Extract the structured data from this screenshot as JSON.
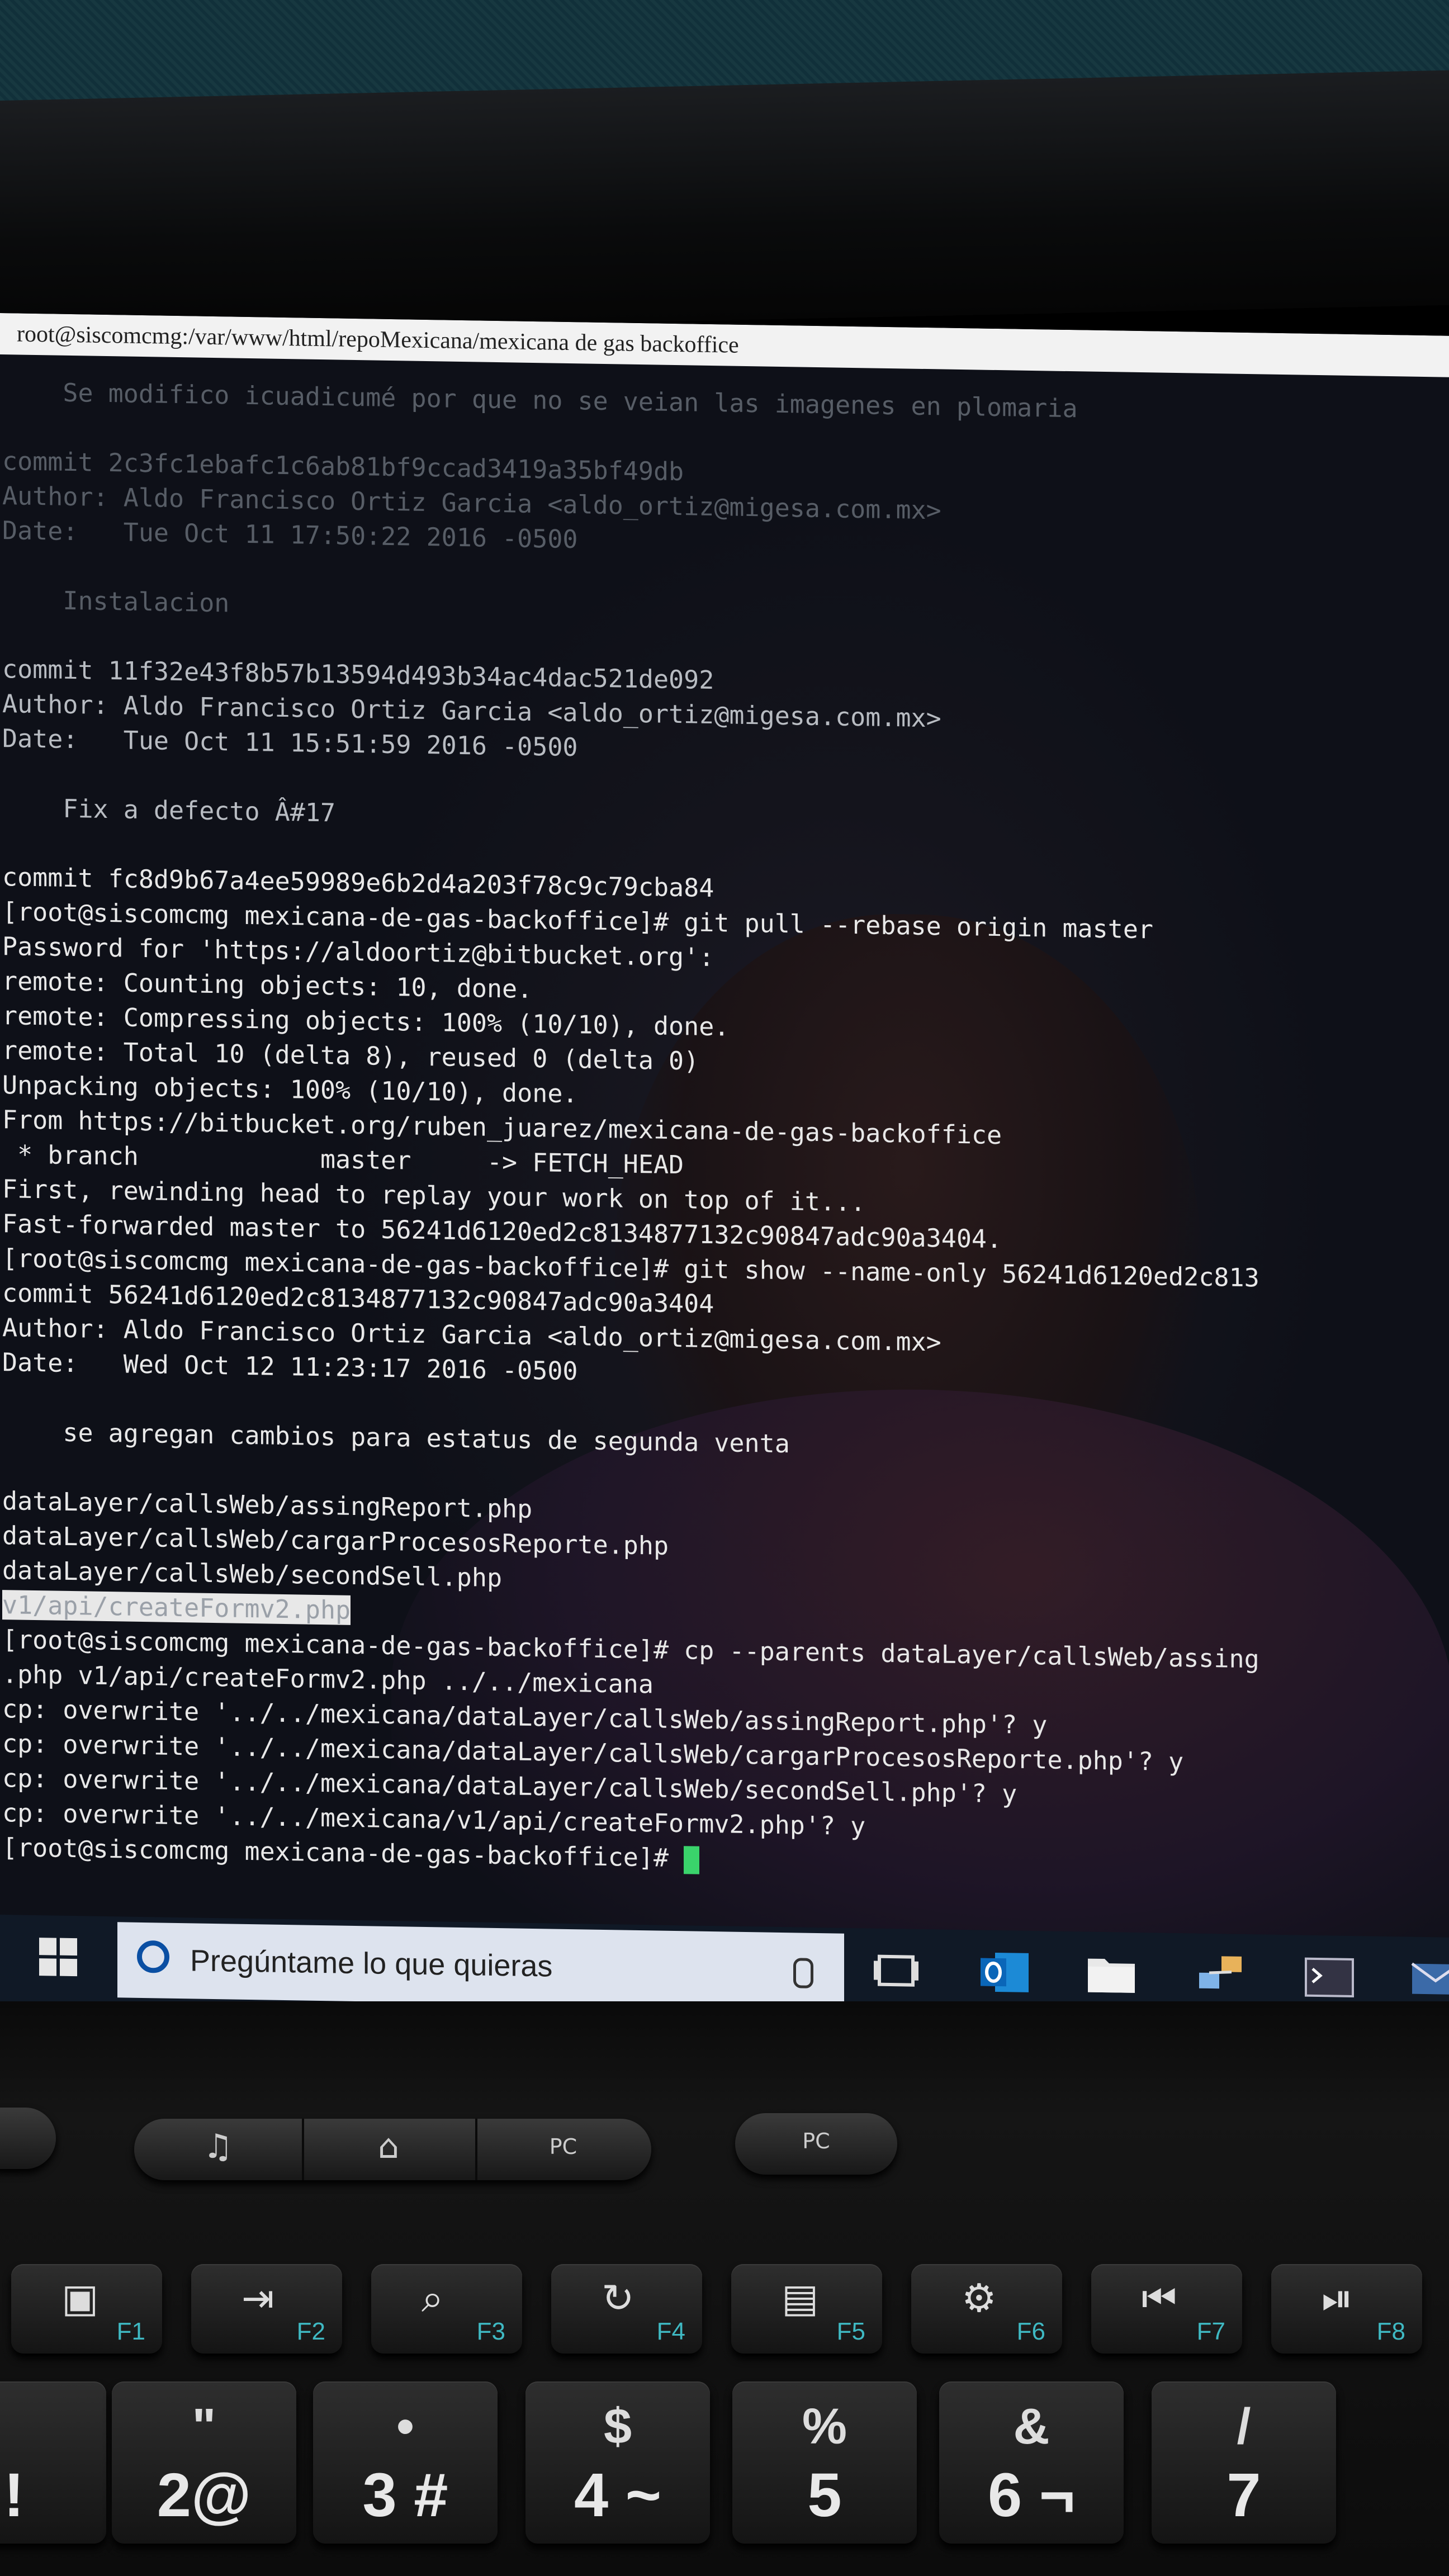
{
  "window": {
    "title": "root@siscomcmg:/var/www/html/repoMexicana/mexicana de gas backoffice"
  },
  "terminal": {
    "lines": [
      {
        "text": "    Se modifico icuadicumé por que no se veian las imagenes en plomaria",
        "tone": "dim"
      },
      {
        "text": "",
        "tone": "dim"
      },
      {
        "text": "commit 2c3fc1ebafc1c6ab81bf9ccad3419a35bf49db",
        "tone": "dim"
      },
      {
        "text": "Author: Aldo Francisco Ortiz Garcia <aldo_ortiz@migesa.com.mx>",
        "tone": "dim"
      },
      {
        "text": "Date:   Tue Oct 11 17:50:22 2016 -0500",
        "tone": "dim"
      },
      {
        "text": "",
        "tone": "dim"
      },
      {
        "text": "    Instalacion",
        "tone": "dim"
      },
      {
        "text": "",
        "tone": "dim"
      },
      {
        "text": "commit 11f32e43f8b57b13594d493b34ac4dac521de092",
        "tone": "mid"
      },
      {
        "text": "Author: Aldo Francisco Ortiz Garcia <aldo_ortiz@migesa.com.mx>",
        "tone": "mid"
      },
      {
        "text": "Date:   Tue Oct 11 15:51:59 2016 -0500",
        "tone": "mid"
      },
      {
        "text": "",
        "tone": "mid"
      },
      {
        "text": "    Fix a defecto Â#17",
        "tone": "mid"
      },
      {
        "text": "",
        "tone": "mid"
      },
      {
        "text": "commit fc8d9b67a4ee59989e6b2d4a203f78c9c79cba84",
        "tone": "bright"
      },
      {
        "text": "[root@siscomcmg mexicana-de-gas-backoffice]# git pull --rebase origin master",
        "tone": "bright"
      },
      {
        "text": "Password for 'https://aldoortiz@bitbucket.org':",
        "tone": "bright"
      },
      {
        "text": "remote: Counting objects: 10, done.",
        "tone": "bright"
      },
      {
        "text": "remote: Compressing objects: 100% (10/10), done.",
        "tone": "bright"
      },
      {
        "text": "remote: Total 10 (delta 8), reused 0 (delta 0)",
        "tone": "bright"
      },
      {
        "text": "Unpacking objects: 100% (10/10), done.",
        "tone": "bright"
      },
      {
        "text": "From https://bitbucket.org/ruben_juarez/mexicana-de-gas-backoffice",
        "tone": "bright"
      },
      {
        "text": " * branch            master     -> FETCH_HEAD",
        "tone": "bright"
      },
      {
        "text": "First, rewinding head to replay your work on top of it...",
        "tone": "bright"
      },
      {
        "text": "Fast-forwarded master to 56241d6120ed2c8134877132c90847adc90a3404.",
        "tone": "bright"
      },
      {
        "text": "[root@siscomcmg mexicana-de-gas-backoffice]# git show --name-only 56241d6120ed2c813",
        "tone": "bright"
      },
      {
        "text": "commit 56241d6120ed2c8134877132c90847adc90a3404",
        "tone": "bright"
      },
      {
        "text": "Author: Aldo Francisco Ortiz Garcia <aldo_ortiz@migesa.com.mx>",
        "tone": "bright"
      },
      {
        "text": "Date:   Wed Oct 12 11:23:17 2016 -0500",
        "tone": "bright"
      },
      {
        "text": "",
        "tone": "bright"
      },
      {
        "text": "    se agregan cambios para estatus de segunda venta",
        "tone": "bright"
      },
      {
        "text": "",
        "tone": "bright"
      },
      {
        "text": "dataLayer/callsWeb/assingReport.php",
        "tone": "bright"
      },
      {
        "text": "dataLayer/callsWeb/cargarProcesosReporte.php",
        "tone": "bright"
      },
      {
        "text": "dataLayer/callsWeb/secondSell.php",
        "tone": "bright"
      },
      {
        "text": "v1/api/createFormv2.php",
        "tone": "highlight"
      },
      {
        "text": "[root@siscomcmg mexicana-de-gas-backoffice]# cp --parents dataLayer/callsWeb/assing",
        "tone": "bright"
      },
      {
        "text": ".php v1/api/createFormv2.php ../../mexicana",
        "tone": "bright"
      },
      {
        "text": "cp: overwrite '../../mexicana/dataLayer/callsWeb/assingReport.php'? y",
        "tone": "bright"
      },
      {
        "text": "cp: overwrite '../../mexicana/dataLayer/callsWeb/cargarProcesosReporte.php'? y",
        "tone": "bright"
      },
      {
        "text": "cp: overwrite '../../mexicana/dataLayer/callsWeb/secondSell.php'? y",
        "tone": "bright"
      },
      {
        "text": "cp: overwrite '../../mexicana/v1/api/createFormv2.php'? y",
        "tone": "bright"
      },
      {
        "text": "[root@siscomcmg mexicana-de-gas-backoffice]# ",
        "tone": "prompt"
      }
    ]
  },
  "taskbar": {
    "search_placeholder": "Pregúntame lo que quieras",
    "icons": [
      "windows-start-icon",
      "cortana-icon",
      "microphone-icon",
      "task-view-icon",
      "outlook-icon",
      "file-explorer-icon",
      "network-icon",
      "terminal-icon",
      "mail-icon"
    ]
  },
  "keyboard": {
    "media_keys": [
      {
        "icon": "music-note-icon",
        "glyph": "♫"
      },
      {
        "icon": "home-icon",
        "glyph": "⌂"
      },
      {
        "icon": "lock-pc-icon",
        "label": "PC"
      },
      {
        "icon": "power-pc-icon",
        "label": "PC"
      }
    ],
    "function_keys": [
      {
        "glyph": "▣",
        "label": "F1"
      },
      {
        "glyph": "⇥",
        "label": "F2"
      },
      {
        "glyph": "⌕",
        "label": "F3"
      },
      {
        "glyph": "↻",
        "label": "F4"
      },
      {
        "glyph": "▤",
        "label": "F5"
      },
      {
        "glyph": "⚙",
        "label": "F6"
      },
      {
        "glyph": "⏮",
        "label": "F7"
      },
      {
        "glyph": "⏯",
        "label": "F8"
      }
    ],
    "number_keys": [
      {
        "top": "",
        "bottom": "!"
      },
      {
        "top": "\"",
        "bottom": "2@"
      },
      {
        "top": "•",
        "bottom": "3 #"
      },
      {
        "top": "$",
        "bottom": "4 ~"
      },
      {
        "top": "%",
        "bottom": "5"
      },
      {
        "top": "&",
        "bottom": "6 ¬"
      },
      {
        "top": "/",
        "bottom": "7"
      }
    ]
  }
}
